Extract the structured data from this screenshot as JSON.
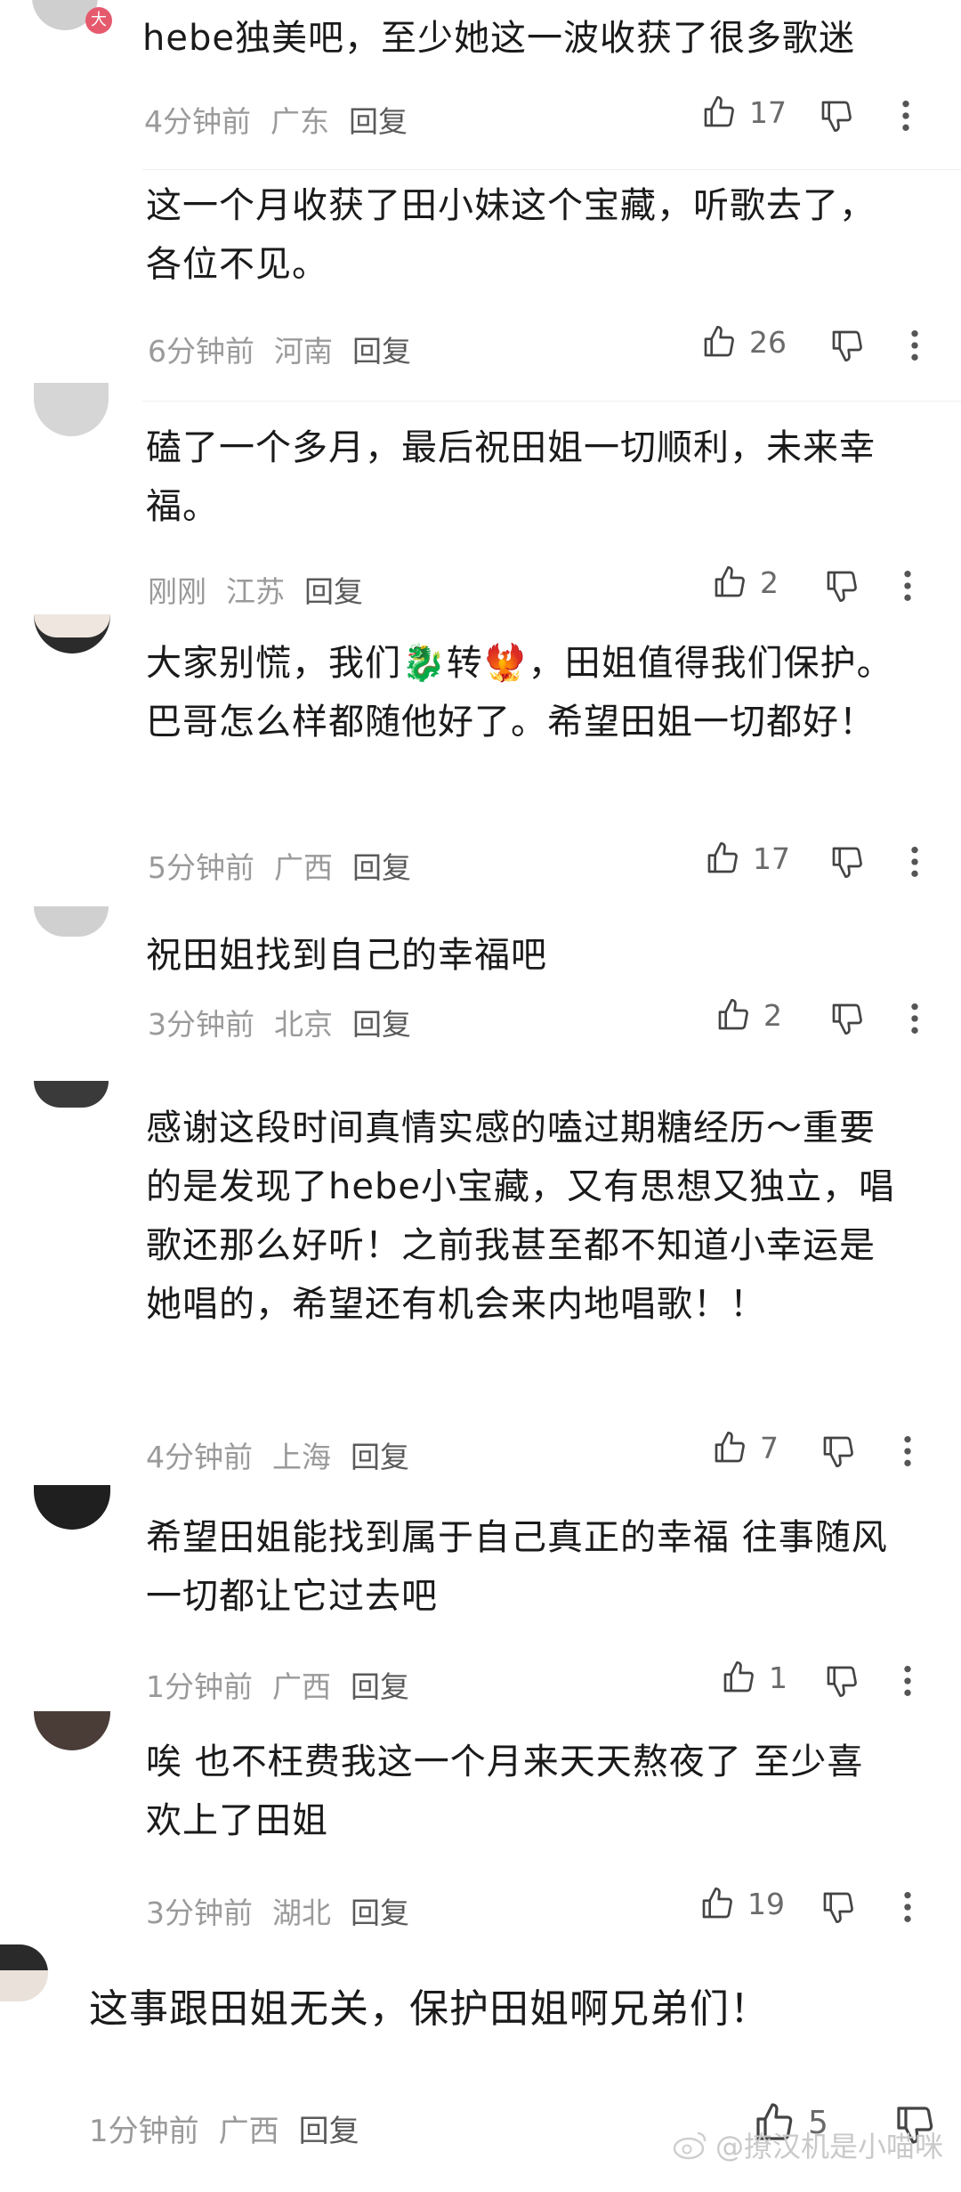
{
  "comments": [
    {
      "text": "hebe独美吧，至少她这一波收获了很多歌迷",
      "time": "4分钟前",
      "location": "广东",
      "reply": "回复",
      "likes": "17",
      "badge": "大"
    },
    {
      "text": "这一个月收获了田小妹这个宝藏，听歌去了，各位不见。",
      "time": "6分钟前",
      "location": "河南",
      "reply": "回复",
      "likes": "26"
    },
    {
      "text": "磕了一个多月，最后祝田姐一切顺利，未来幸福。",
      "time": "刚刚",
      "location": "江苏",
      "reply": "回复",
      "likes": "2"
    },
    {
      "text": "大家别慌，我们🐉转🐦‍🔥，田姐值得我们保护。巴哥怎么样都随他好了。希望田姐一切都好！",
      "time": "5分钟前",
      "location": "广西",
      "reply": "回复",
      "likes": "17"
    },
    {
      "text": "祝田姐找到自己的幸福吧",
      "time": "3分钟前",
      "location": "北京",
      "reply": "回复",
      "likes": "2"
    },
    {
      "text": "感谢这段时间真情实感的嗑过期糖经历～重要的是发现了hebe小宝藏，又有思想又独立，唱歌还那么好听！之前我甚至都不知道小幸运是她唱的，希望还有机会来内地唱歌！！",
      "time": "4分钟前",
      "location": "上海",
      "reply": "回复",
      "likes": "7"
    },
    {
      "text": "希望田姐能找到属于自己真正的幸福 往事随风 一切都让它过去吧",
      "time": "1分钟前",
      "location": "广西",
      "reply": "回复",
      "likes": "1"
    },
    {
      "text": "唉  也不枉费我这一个月来天天熬夜了  至少喜欢上了田姐",
      "time": "3分钟前",
      "location": "湖北",
      "reply": "回复",
      "likes": "19"
    },
    {
      "text": "这事跟田姐无关，保护田姐啊兄弟们！",
      "time": "1分钟前",
      "location": "广西",
      "reply": "回复",
      "likes": "5"
    }
  ],
  "watermark": "@撩汉机是小喵咪",
  "icons": {
    "like": "thumbs-up-icon",
    "dislike": "thumbs-down-icon",
    "more": "more-vertical-icon",
    "weibo": "weibo-logo-icon"
  }
}
